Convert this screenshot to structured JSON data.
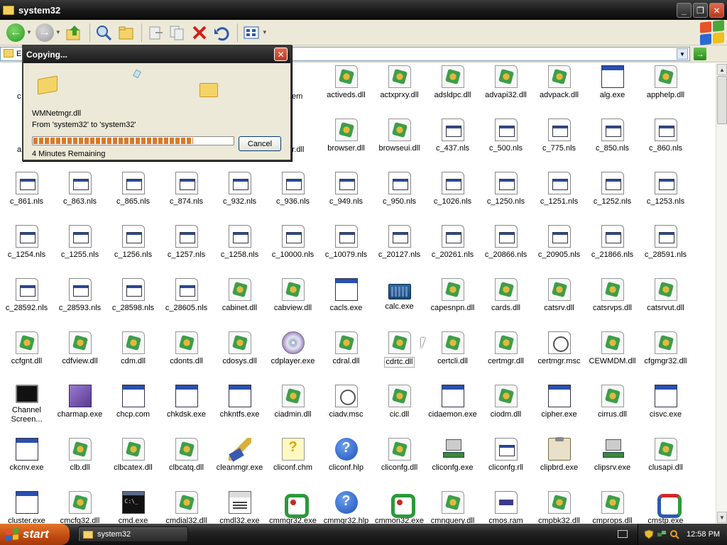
{
  "window": {
    "title": "system32"
  },
  "address": {
    "partial_text": "E"
  },
  "dialog": {
    "title": "Copying...",
    "file": "WMNetmgr.dll",
    "from_to": "From 'system32' to 'system32'",
    "remaining": "4 Minutes Remaining",
    "progress_fraction": 0.8,
    "cancel_label": "Cancel"
  },
  "hidden_labels": [
    "c",
    "a",
    "em",
    "eter.dll"
  ],
  "files_row0_visible": [
    {
      "label": "activeds.dll",
      "icon": "dll"
    },
    {
      "label": "actxprxy.dll",
      "icon": "dll"
    },
    {
      "label": "adsldpc.dll",
      "icon": "dll"
    },
    {
      "label": "advapi32.dll",
      "icon": "dll"
    },
    {
      "label": "advpack.dll",
      "icon": "dll"
    },
    {
      "label": "alg.exe",
      "icon": "exe"
    },
    {
      "label": "apphelp.dll",
      "icon": "dll"
    }
  ],
  "files_row1_visible": [
    {
      "label": "browser.dll",
      "icon": "dll"
    },
    {
      "label": "browseui.dll",
      "icon": "dll"
    },
    {
      "label": "c_437.nls",
      "icon": "nls"
    },
    {
      "label": "c_500.nls",
      "icon": "nls"
    },
    {
      "label": "c_775.nls",
      "icon": "nls"
    },
    {
      "label": "c_850.nls",
      "icon": "nls"
    },
    {
      "label": "c_860.nls",
      "icon": "nls"
    }
  ],
  "files": [
    {
      "label": "c_861.nls",
      "icon": "nls"
    },
    {
      "label": "c_863.nls",
      "icon": "nls"
    },
    {
      "label": "c_865.nls",
      "icon": "nls"
    },
    {
      "label": "c_874.nls",
      "icon": "nls"
    },
    {
      "label": "c_932.nls",
      "icon": "nls"
    },
    {
      "label": "c_936.nls",
      "icon": "nls"
    },
    {
      "label": "c_949.nls",
      "icon": "nls"
    },
    {
      "label": "c_950.nls",
      "icon": "nls"
    },
    {
      "label": "c_1026.nls",
      "icon": "nls"
    },
    {
      "label": "c_1250.nls",
      "icon": "nls"
    },
    {
      "label": "c_1251.nls",
      "icon": "nls"
    },
    {
      "label": "c_1252.nls",
      "icon": "nls"
    },
    {
      "label": "c_1253.nls",
      "icon": "nls"
    },
    {
      "label": "c_1254.nls",
      "icon": "nls"
    },
    {
      "label": "c_1255.nls",
      "icon": "nls"
    },
    {
      "label": "c_1256.nls",
      "icon": "nls"
    },
    {
      "label": "c_1257.nls",
      "icon": "nls"
    },
    {
      "label": "c_1258.nls",
      "icon": "nls"
    },
    {
      "label": "c_10000.nls",
      "icon": "nls"
    },
    {
      "label": "c_10079.nls",
      "icon": "nls"
    },
    {
      "label": "c_20127.nls",
      "icon": "nls"
    },
    {
      "label": "c_20261.nls",
      "icon": "nls"
    },
    {
      "label": "c_20866.nls",
      "icon": "nls"
    },
    {
      "label": "c_20905.nls",
      "icon": "nls"
    },
    {
      "label": "c_21866.nls",
      "icon": "nls"
    },
    {
      "label": "c_28591.nls",
      "icon": "nls"
    },
    {
      "label": "c_28592.nls",
      "icon": "nls"
    },
    {
      "label": "c_28593.nls",
      "icon": "nls"
    },
    {
      "label": "c_28598.nls",
      "icon": "nls"
    },
    {
      "label": "c_28605.nls",
      "icon": "nls"
    },
    {
      "label": "cabinet.dll",
      "icon": "dll"
    },
    {
      "label": "cabview.dll",
      "icon": "dll"
    },
    {
      "label": "cacls.exe",
      "icon": "exe"
    },
    {
      "label": "calc.exe",
      "icon": "calc"
    },
    {
      "label": "capesnpn.dll",
      "icon": "dll"
    },
    {
      "label": "cards.dll",
      "icon": "dll"
    },
    {
      "label": "catsrv.dll",
      "icon": "dll"
    },
    {
      "label": "catsrvps.dll",
      "icon": "dll"
    },
    {
      "label": "catsrvut.dll",
      "icon": "dll"
    },
    {
      "label": "ccfgnt.dll",
      "icon": "dll"
    },
    {
      "label": "cdfview.dll",
      "icon": "dll"
    },
    {
      "label": "cdm.dll",
      "icon": "dll"
    },
    {
      "label": "cdonts.dll",
      "icon": "dll"
    },
    {
      "label": "cdosys.dll",
      "icon": "dll"
    },
    {
      "label": "cdplayer.exe",
      "icon": "cd"
    },
    {
      "label": "cdral.dll",
      "icon": "dll"
    },
    {
      "label": "cdrtc.dll",
      "icon": "dll",
      "selected": true
    },
    {
      "label": "certcli.dll",
      "icon": "dll"
    },
    {
      "label": "certmgr.dll",
      "icon": "dll"
    },
    {
      "label": "certmgr.msc",
      "icon": "msc"
    },
    {
      "label": "CEWMDM.dll",
      "icon": "dll"
    },
    {
      "label": "cfgmgr32.dll",
      "icon": "dll"
    },
    {
      "label": "Channel Screen...",
      "icon": "monitor",
      "wrap": true
    },
    {
      "label": "charmap.exe",
      "icon": "cube"
    },
    {
      "label": "chcp.com",
      "icon": "exe"
    },
    {
      "label": "chkdsk.exe",
      "icon": "exe"
    },
    {
      "label": "chkntfs.exe",
      "icon": "exe"
    },
    {
      "label": "ciadmin.dll",
      "icon": "dll"
    },
    {
      "label": "ciadv.msc",
      "icon": "msc"
    },
    {
      "label": "cic.dll",
      "icon": "dll"
    },
    {
      "label": "cidaemon.exe",
      "icon": "exe"
    },
    {
      "label": "ciodm.dll",
      "icon": "dll"
    },
    {
      "label": "cipher.exe",
      "icon": "exe"
    },
    {
      "label": "cirrus.dll",
      "icon": "dll"
    },
    {
      "label": "cisvc.exe",
      "icon": "exe"
    },
    {
      "label": "ckcnv.exe",
      "icon": "exe"
    },
    {
      "label": "clb.dll",
      "icon": "dll"
    },
    {
      "label": "clbcatex.dll",
      "icon": "dll"
    },
    {
      "label": "clbcatq.dll",
      "icon": "dll"
    },
    {
      "label": "cleanmgr.exe",
      "icon": "broom"
    },
    {
      "label": "cliconf.chm",
      "icon": "chm"
    },
    {
      "label": "cliconf.hlp",
      "icon": "help"
    },
    {
      "label": "cliconfg.dll",
      "icon": "dll"
    },
    {
      "label": "cliconfg.exe",
      "icon": "net"
    },
    {
      "label": "cliconfg.rll",
      "icon": "nls"
    },
    {
      "label": "clipbrd.exe",
      "icon": "clip"
    },
    {
      "label": "clipsrv.exe",
      "icon": "net"
    },
    {
      "label": "clusapi.dll",
      "icon": "dll"
    },
    {
      "label": "cluster.exe",
      "icon": "exe"
    },
    {
      "label": "cmcfg32.dll",
      "icon": "dll"
    },
    {
      "label": "cmd.exe",
      "icon": "cmd"
    },
    {
      "label": "cmdial32.dll",
      "icon": "dll"
    },
    {
      "label": "cmdl32.exe",
      "icon": "dial"
    },
    {
      "label": "cmmgr32.exe",
      "icon": "green"
    },
    {
      "label": "cmmgr32.hlp",
      "icon": "help"
    },
    {
      "label": "cmmon32.exe",
      "icon": "green"
    },
    {
      "label": "cmnquery.dll",
      "icon": "dll"
    },
    {
      "label": "cmos.ram",
      "icon": "ram"
    },
    {
      "label": "cmpbk32.dll",
      "icon": "dll"
    },
    {
      "label": "cmprops.dll",
      "icon": "dll"
    },
    {
      "label": "cmstp.exe",
      "icon": "mixed"
    }
  ],
  "taskbar": {
    "start_label": "start",
    "task_label": "system32",
    "clock": "12:58 PM"
  },
  "colors": {
    "start": "#c04a12",
    "progress": "#d87a28",
    "xp_red": "#e8502a",
    "xp_green": "#4aa83a",
    "xp_blue": "#2a6ad0",
    "xp_yellow": "#f0c020"
  }
}
